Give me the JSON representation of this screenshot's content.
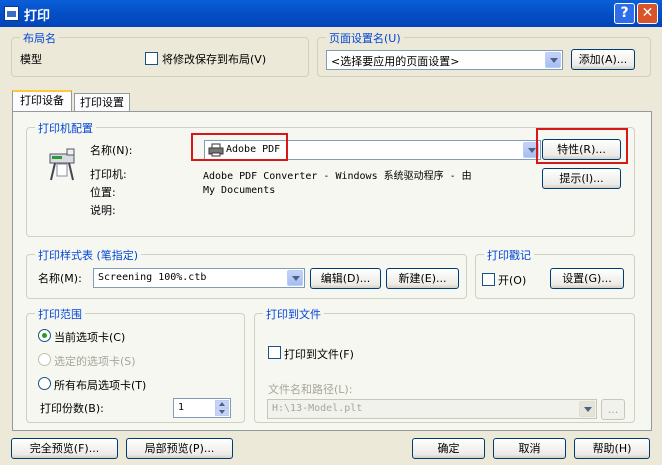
{
  "window": {
    "title": "打印",
    "help_btn": "?",
    "close_btn": "✕"
  },
  "layout_group": {
    "label": "布局名",
    "name": "模型",
    "save_checkbox_label": "将修改保存到布局(V)"
  },
  "pagesetup_group": {
    "label": "页面设置名(U)",
    "select_value": "<选择要应用的页面设置>",
    "add_button": "添加(A)..."
  },
  "tabs": [
    {
      "label": "打印设备"
    },
    {
      "label": "打印设置"
    }
  ],
  "printer_config": {
    "label": "打印机配置",
    "name_label": "名称(N):",
    "name_value": "Adobe PDF",
    "properties_button": "特性(R)...",
    "hint_button": "提示(I)...",
    "printer_label": "打印机:",
    "printer_value": "Adobe PDF Converter - Windows 系统驱动程序 - 由",
    "location_label": "位置:",
    "location_value": "My Documents",
    "desc_label": "说明:"
  },
  "plot_style": {
    "label": "打印样式表 (笔指定)",
    "name_label": "名称(M):",
    "name_value": "Screening 100%.ctb",
    "edit_button": "编辑(D)...",
    "new_button": "新建(E)..."
  },
  "plot_stamp": {
    "label": "打印戳记",
    "on_label": "开(O)",
    "settings_button": "设置(G)..."
  },
  "plot_range": {
    "label": "打印范围",
    "option_current": "当前选项卡(C)",
    "option_selected": "选定的选项卡(S)",
    "option_all": "所有布局选项卡(T)",
    "copies_label": "打印份数(B):",
    "copies_value": "1"
  },
  "plot_to_file": {
    "label": "打印到文件",
    "checkbox_label": "打印到文件(F)",
    "path_label": "文件名和路径(L):",
    "path_value": "H:\\13-Model.plt",
    "browse": "..."
  },
  "footer": {
    "full_preview": "完全预览(F)...",
    "partial_preview": "局部预览(P)...",
    "ok": "确定",
    "cancel": "取消",
    "help": "帮助(H)"
  }
}
